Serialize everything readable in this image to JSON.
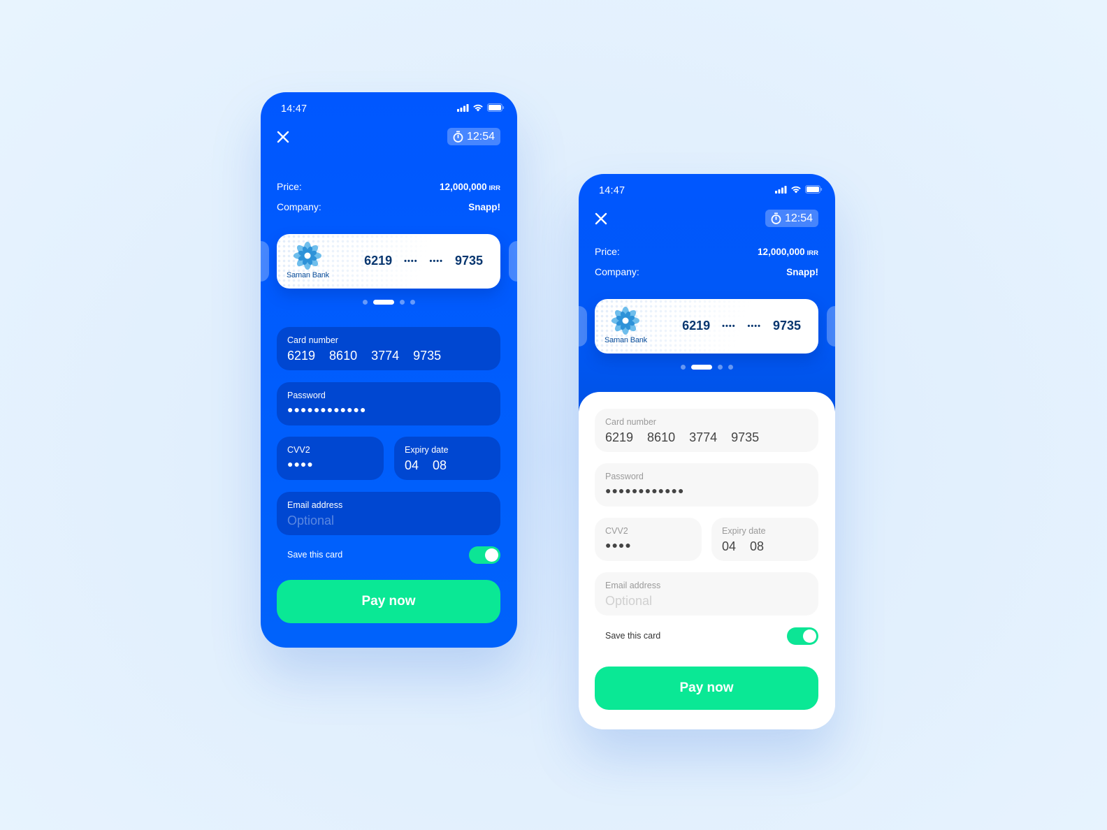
{
  "colors": {
    "brand_blue": "#0057ff",
    "field_blue": "#0047d1",
    "accent_green": "#0ae895",
    "card_text": "#08366f",
    "background": "#e1effd"
  },
  "screens": [
    {
      "variant": "blue",
      "status_bar": {
        "time": "14:47",
        "icons": [
          "signal-icon",
          "wifi-icon",
          "battery-icon"
        ]
      },
      "header": {
        "close_icon": "close-icon",
        "timer_icon": "stopwatch-icon",
        "timer": "12:54"
      },
      "summary": {
        "price_label": "Price:",
        "price_value": "12,000,000",
        "currency": "IRR",
        "company_label": "Company:",
        "company_value": "Snapp!"
      },
      "selected_card": {
        "bank_name": "Saman Bank",
        "groups": [
          "6219",
          "••••",
          "••••",
          "9735"
        ]
      },
      "pager": {
        "count": 4,
        "active_index": 1
      },
      "form": {
        "card_number": {
          "label": "Card number",
          "groups": [
            "6219",
            "8610",
            "3774",
            "9735"
          ]
        },
        "password": {
          "label": "Password",
          "value": "●●●●●●●●●●●●"
        },
        "cvv2": {
          "label": "CVV2",
          "value": "●●●●"
        },
        "expiry": {
          "label": "Expiry date",
          "month": "04",
          "year": "08"
        },
        "email": {
          "label": "Email address",
          "placeholder": "Optional",
          "value": ""
        },
        "save_card": {
          "label": "Save this card",
          "enabled": true
        }
      },
      "pay_button": "Pay now"
    },
    {
      "variant": "white",
      "status_bar": {
        "time": "14:47",
        "icons": [
          "signal-icon",
          "wifi-icon",
          "battery-icon"
        ]
      },
      "header": {
        "close_icon": "close-icon",
        "timer_icon": "stopwatch-icon",
        "timer": "12:54"
      },
      "summary": {
        "price_label": "Price:",
        "price_value": "12,000,000",
        "currency": "IRR",
        "company_label": "Company:",
        "company_value": "Snapp!"
      },
      "selected_card": {
        "bank_name": "Saman Bank",
        "groups": [
          "6219",
          "••••",
          "••••",
          "9735"
        ]
      },
      "pager": {
        "count": 4,
        "active_index": 1
      },
      "form": {
        "card_number": {
          "label": "Card number",
          "groups": [
            "6219",
            "8610",
            "3774",
            "9735"
          ]
        },
        "password": {
          "label": "Password",
          "value": "●●●●●●●●●●●●"
        },
        "cvv2": {
          "label": "CVV2",
          "value": "●●●●"
        },
        "expiry": {
          "label": "Expiry date",
          "month": "04",
          "year": "08"
        },
        "email": {
          "label": "Email address",
          "placeholder": "Optional",
          "value": ""
        },
        "save_card": {
          "label": "Save this card",
          "enabled": true
        }
      },
      "pay_button": "Pay now"
    }
  ]
}
